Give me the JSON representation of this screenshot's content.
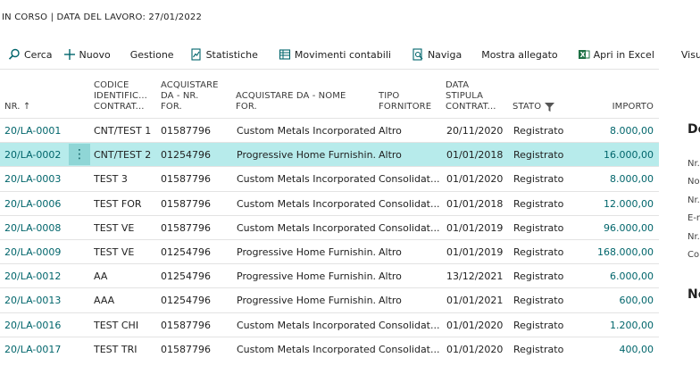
{
  "caption": "IN CORSO | DATA DEL LAVORO: 27/01/2022",
  "actions": [
    {
      "label": "Cerca",
      "icon": "search-icon"
    },
    {
      "label": "Nuovo",
      "icon": "plus-icon"
    },
    {
      "label": "Gestione",
      "icon": ""
    },
    {
      "label": "Statistiche",
      "icon": "statistics-icon"
    },
    {
      "label": "Movimenti contabili",
      "icon": "ledger-entries-icon"
    },
    {
      "label": "Naviga",
      "icon": "navigate-icon"
    },
    {
      "label": "Mostra allegato",
      "icon": ""
    },
    {
      "label": "Apri in Excel",
      "icon": "excel-icon"
    },
    {
      "label": "Visualizza",
      "icon": ""
    }
  ],
  "columns": {
    "nr": "NR. ↑",
    "codice": [
      "CODICE",
      "IDENTIFIC...",
      "CONTRAT..."
    ],
    "acqnr": [
      "ACQUISTARE",
      "DA - NR.",
      "FOR."
    ],
    "acqnome": [
      "ACQUISTARE DA - NOME",
      "FOR."
    ],
    "tipo": [
      "TIPO",
      "FORNITORE"
    ],
    "data": [
      "DATA",
      "STIPULA",
      "CONTRAT..."
    ],
    "stato": "STATO",
    "importo": "IMPORTO"
  },
  "rows": [
    {
      "nr": "20/LA-0001",
      "codice": "CNT/TEST 1",
      "acqnr": "01587796",
      "nome": "Custom Metals Incorporated",
      "tipo": "Altro",
      "data": "20/11/2020",
      "stato": "Registrato",
      "importo": "8.000,00"
    },
    {
      "nr": "20/LA-0002",
      "codice": "CNT/TEST 2",
      "acqnr": "01254796",
      "nome": "Progressive Home Furnishin...",
      "tipo": "Altro",
      "data": "01/01/2018",
      "stato": "Registrato",
      "importo": "16.000,00"
    },
    {
      "nr": "20/LA-0003",
      "codice": "TEST 3",
      "acqnr": "01587796",
      "nome": "Custom Metals Incorporated",
      "tipo": "Consolidat...",
      "data": "01/01/2020",
      "stato": "Registrato",
      "importo": "8.000,00"
    },
    {
      "nr": "20/LA-0006",
      "codice": "TEST FOR",
      "acqnr": "01587796",
      "nome": "Custom Metals Incorporated",
      "tipo": "Consolidat...",
      "data": "01/01/2018",
      "stato": "Registrato",
      "importo": "12.000,00"
    },
    {
      "nr": "20/LA-0008",
      "codice": "TEST VE",
      "acqnr": "01587796",
      "nome": "Custom Metals Incorporated",
      "tipo": "Consolidat...",
      "data": "01/01/2019",
      "stato": "Registrato",
      "importo": "96.000,00"
    },
    {
      "nr": "20/LA-0009",
      "codice": "TEST VE",
      "acqnr": "01254796",
      "nome": "Progressive Home Furnishin...",
      "tipo": "Altro",
      "data": "01/01/2019",
      "stato": "Registrato",
      "importo": "168.000,00"
    },
    {
      "nr": "20/LA-0012",
      "codice": "AA",
      "acqnr": "01254796",
      "nome": "Progressive Home Furnishin...",
      "tipo": "Altro",
      "data": "13/12/2021",
      "stato": "Registrato",
      "importo": "6.000,00"
    },
    {
      "nr": "20/LA-0013",
      "codice": "AAA",
      "acqnr": "01254796",
      "nome": "Progressive Home Furnishin...",
      "tipo": "Altro",
      "data": "01/01/2021",
      "stato": "Registrato",
      "importo": "600,00"
    },
    {
      "nr": "20/LA-0016",
      "codice": "TEST CHI",
      "acqnr": "01587796",
      "nome": "Custom Metals Incorporated",
      "tipo": "Consolidat...",
      "data": "01/01/2020",
      "stato": "Registrato",
      "importo": "1.200,00"
    },
    {
      "nr": "20/LA-0017",
      "codice": "TEST TRI",
      "acqnr": "01587796",
      "nome": "Custom Metals Incorporated",
      "tipo": "Consolidat...",
      "data": "01/01/2020",
      "stato": "Registrato",
      "importo": "400,00"
    }
  ],
  "selected_row_index": 1,
  "row_menu_glyph": "⋮",
  "factbox": {
    "title": "De",
    "fields": [
      "Nr.",
      "No",
      "Nr.",
      "E-r",
      "Nr.",
      "Co"
    ],
    "section2": "Ne"
  }
}
